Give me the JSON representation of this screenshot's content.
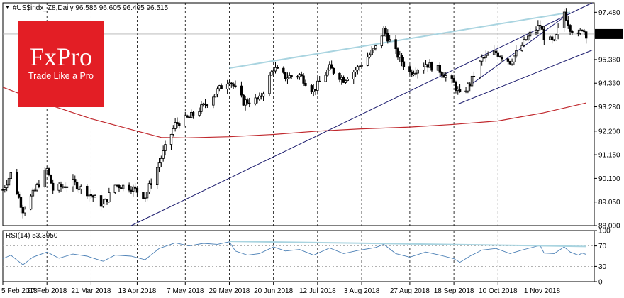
{
  "header": {
    "symbol": "#US$indx_Z8",
    "timeframe": "Daily",
    "ohlc": "96.585 96.605 96.495 96.515"
  },
  "logo": {
    "brand": "FxPro",
    "tagline": "Trade Like a Pro"
  },
  "colors": {
    "candle": "#000000",
    "ma": "#c0282d",
    "rsi": "#4a7fb5",
    "upper_trend": "#a9d4e0",
    "channel": "#1c1c6e",
    "current_price_bg": "#000000"
  },
  "chart_data": [
    {
      "type": "candlestick",
      "title": "#US$indx_Z8 Daily",
      "current_price": "96.515",
      "ylim": [
        88.0,
        97.9
      ],
      "y_ticks": [
        "97.480",
        "96.515",
        "95.380",
        "94.330",
        "93.280",
        "92.200",
        "91.150",
        "90.100",
        "89.050",
        "88.000"
      ],
      "x_ticks": [
        "5 Feb 2018",
        "27 Feb 2018",
        "21 Mar 2018",
        "13 Apr 2018",
        "7 May 2018",
        "29 May 2018",
        "20 Jun 2018",
        "12 Jul 2018",
        "3 Aug 2018",
        "27 Aug 2018",
        "18 Sep 2018",
        "10 Oct 2018",
        "1 Nov 2018"
      ],
      "close_path": [
        {
          "x": "2018-02-05",
          "y": 89.6
        },
        {
          "x": "2018-02-09",
          "y": 90.3
        },
        {
          "x": "2018-02-15",
          "y": 88.7
        },
        {
          "x": "2018-02-20",
          "y": 89.4
        },
        {
          "x": "2018-02-27",
          "y": 90.5
        },
        {
          "x": "2018-03-02",
          "y": 89.6
        },
        {
          "x": "2018-03-12",
          "y": 89.9
        },
        {
          "x": "2018-03-19",
          "y": 89.5
        },
        {
          "x": "2018-03-27",
          "y": 88.9
        },
        {
          "x": "2018-04-02",
          "y": 89.8
        },
        {
          "x": "2018-04-10",
          "y": 89.7
        },
        {
          "x": "2018-04-17",
          "y": 89.3
        },
        {
          "x": "2018-04-24",
          "y": 90.8
        },
        {
          "x": "2018-05-02",
          "y": 92.5
        },
        {
          "x": "2018-05-09",
          "y": 92.8
        },
        {
          "x": "2018-05-16",
          "y": 93.3
        },
        {
          "x": "2018-05-23",
          "y": 94.0
        },
        {
          "x": "2018-05-29",
          "y": 94.5
        },
        {
          "x": "2018-06-05",
          "y": 93.5
        },
        {
          "x": "2018-06-13",
          "y": 93.6
        },
        {
          "x": "2018-06-20",
          "y": 95.0
        },
        {
          "x": "2018-06-26",
          "y": 94.6
        },
        {
          "x": "2018-07-03",
          "y": 94.7
        },
        {
          "x": "2018-07-10",
          "y": 94.0
        },
        {
          "x": "2018-07-18",
          "y": 95.0
        },
        {
          "x": "2018-07-25",
          "y": 94.5
        },
        {
          "x": "2018-08-01",
          "y": 95.0
        },
        {
          "x": "2018-08-10",
          "y": 95.9
        },
        {
          "x": "2018-08-14",
          "y": 96.7
        },
        {
          "x": "2018-08-20",
          "y": 95.7
        },
        {
          "x": "2018-08-27",
          "y": 94.8
        },
        {
          "x": "2018-09-04",
          "y": 95.2
        },
        {
          "x": "2018-09-11",
          "y": 94.9
        },
        {
          "x": "2018-09-18",
          "y": 94.3
        },
        {
          "x": "2018-09-21",
          "y": 93.8
        },
        {
          "x": "2018-09-26",
          "y": 94.3
        },
        {
          "x": "2018-10-02",
          "y": 95.4
        },
        {
          "x": "2018-10-09",
          "y": 95.7
        },
        {
          "x": "2018-10-16",
          "y": 95.3
        },
        {
          "x": "2018-10-22",
          "y": 96.0
        },
        {
          "x": "2018-10-26",
          "y": 96.5
        },
        {
          "x": "2018-10-31",
          "y": 96.9
        },
        {
          "x": "2018-11-02",
          "y": 96.4
        },
        {
          "x": "2018-11-07",
          "y": 96.1
        },
        {
          "x": "2018-11-12",
          "y": 97.5
        },
        {
          "x": "2018-11-15",
          "y": 96.8
        },
        {
          "x": "2018-11-19",
          "y": 96.4
        },
        {
          "x": "2018-11-21",
          "y": 96.8
        },
        {
          "x": "2018-11-23",
          "y": 96.5
        }
      ],
      "ma_path": [
        {
          "x": "2018-02-05",
          "y": 94.15
        },
        {
          "x": "2018-02-27",
          "y": 93.4
        },
        {
          "x": "2018-03-21",
          "y": 92.75
        },
        {
          "x": "2018-04-13",
          "y": 92.2
        },
        {
          "x": "2018-04-25",
          "y": 91.92
        },
        {
          "x": "2018-05-07",
          "y": 91.9
        },
        {
          "x": "2018-05-29",
          "y": 91.95
        },
        {
          "x": "2018-06-20",
          "y": 92.05
        },
        {
          "x": "2018-07-12",
          "y": 92.2
        },
        {
          "x": "2018-08-03",
          "y": 92.3
        },
        {
          "x": "2018-08-27",
          "y": 92.38
        },
        {
          "x": "2018-09-18",
          "y": 92.5
        },
        {
          "x": "2018-10-10",
          "y": 92.65
        },
        {
          "x": "2018-11-01",
          "y": 93.0
        },
        {
          "x": "2018-11-23",
          "y": 93.45
        }
      ],
      "upper_trendline": [
        {
          "x": "2018-05-29",
          "y": 95.0
        },
        {
          "x": "2018-11-15",
          "y": 97.48
        }
      ],
      "long_trendline": [
        {
          "x": "2018-04-10",
          "y": 88.0
        },
        {
          "x": "2018-11-26",
          "y": 97.9
        }
      ],
      "channel_lower": [
        {
          "x": "2018-09-20",
          "y": 93.4
        },
        {
          "x": "2018-11-26",
          "y": 95.8
        }
      ],
      "channel_upper": [
        {
          "x": "2018-09-27",
          "y": 94.3
        },
        {
          "x": "2018-11-14",
          "y": 97.4
        }
      ]
    },
    {
      "type": "line",
      "title": "RSI(14) 53.3950",
      "ylim": [
        0,
        100
      ],
      "y_ticks": [
        "100",
        "70",
        "30",
        "0"
      ],
      "levels": [
        70,
        30
      ],
      "values": [
        {
          "x": "2018-02-05",
          "y": 45
        },
        {
          "x": "2018-02-09",
          "y": 52
        },
        {
          "x": "2018-02-15",
          "y": 33
        },
        {
          "x": "2018-02-20",
          "y": 48
        },
        {
          "x": "2018-02-27",
          "y": 58
        },
        {
          "x": "2018-03-05",
          "y": 46
        },
        {
          "x": "2018-03-12",
          "y": 54
        },
        {
          "x": "2018-03-19",
          "y": 50
        },
        {
          "x": "2018-03-27",
          "y": 40
        },
        {
          "x": "2018-04-02",
          "y": 52
        },
        {
          "x": "2018-04-10",
          "y": 50
        },
        {
          "x": "2018-04-17",
          "y": 43
        },
        {
          "x": "2018-04-24",
          "y": 65
        },
        {
          "x": "2018-05-02",
          "y": 76
        },
        {
          "x": "2018-05-09",
          "y": 70
        },
        {
          "x": "2018-05-16",
          "y": 75
        },
        {
          "x": "2018-05-23",
          "y": 73
        },
        {
          "x": "2018-05-29",
          "y": 78
        },
        {
          "x": "2018-06-01",
          "y": 60
        },
        {
          "x": "2018-06-07",
          "y": 52
        },
        {
          "x": "2018-06-13",
          "y": 55
        },
        {
          "x": "2018-06-20",
          "y": 68
        },
        {
          "x": "2018-06-26",
          "y": 60
        },
        {
          "x": "2018-07-03",
          "y": 63
        },
        {
          "x": "2018-07-10",
          "y": 52
        },
        {
          "x": "2018-07-18",
          "y": 66
        },
        {
          "x": "2018-07-25",
          "y": 55
        },
        {
          "x": "2018-08-01",
          "y": 61
        },
        {
          "x": "2018-08-10",
          "y": 67
        },
        {
          "x": "2018-08-14",
          "y": 73
        },
        {
          "x": "2018-08-20",
          "y": 55
        },
        {
          "x": "2018-08-27",
          "y": 48
        },
        {
          "x": "2018-09-04",
          "y": 58
        },
        {
          "x": "2018-09-11",
          "y": 52
        },
        {
          "x": "2018-09-18",
          "y": 45
        },
        {
          "x": "2018-09-21",
          "y": 38
        },
        {
          "x": "2018-09-26",
          "y": 50
        },
        {
          "x": "2018-10-02",
          "y": 62
        },
        {
          "x": "2018-10-09",
          "y": 65
        },
        {
          "x": "2018-10-16",
          "y": 55
        },
        {
          "x": "2018-10-22",
          "y": 62
        },
        {
          "x": "2018-10-26",
          "y": 66
        },
        {
          "x": "2018-10-31",
          "y": 71
        },
        {
          "x": "2018-11-02",
          "y": 56
        },
        {
          "x": "2018-11-07",
          "y": 55
        },
        {
          "x": "2018-11-12",
          "y": 68
        },
        {
          "x": "2018-11-15",
          "y": 58
        },
        {
          "x": "2018-11-19",
          "y": 52
        },
        {
          "x": "2018-11-21",
          "y": 56
        },
        {
          "x": "2018-11-23",
          "y": 53.4
        }
      ],
      "trendline": [
        {
          "x": "2018-05-29",
          "y": 79
        },
        {
          "x": "2018-11-23",
          "y": 69
        }
      ]
    }
  ]
}
